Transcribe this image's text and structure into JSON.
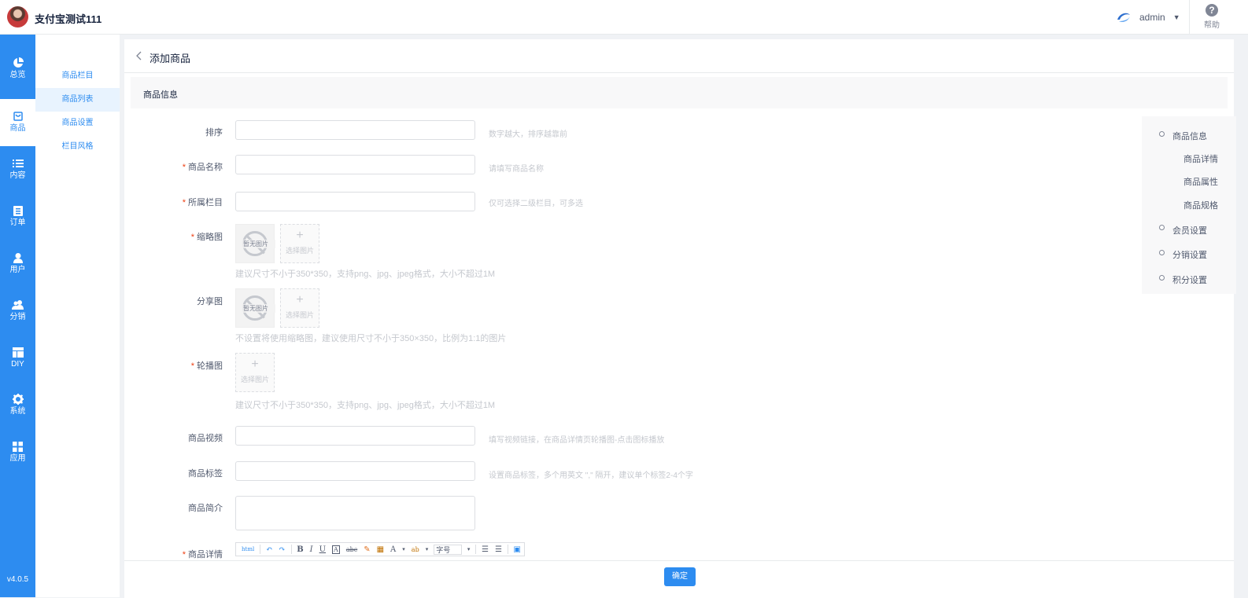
{
  "topbar": {
    "brand": "支付宝测试111",
    "user": "admin",
    "help_label": "帮助",
    "help_glyph": "?"
  },
  "nav": {
    "items": [
      {
        "label": "总览",
        "icon": "pie-chart-icon"
      },
      {
        "label": "商品",
        "icon": "shopping-bag-icon"
      },
      {
        "label": "内容",
        "icon": "list-icon"
      },
      {
        "label": "订单",
        "icon": "document-icon"
      },
      {
        "label": "用户",
        "icon": "user-icon"
      },
      {
        "label": "分销",
        "icon": "users-icon"
      },
      {
        "label": "DIY",
        "icon": "layout-icon"
      },
      {
        "label": "系统",
        "icon": "gear-icon"
      },
      {
        "label": "应用",
        "icon": "apps-icon"
      }
    ],
    "active": "商品",
    "version": "v4.0.5"
  },
  "subnav": {
    "items": [
      "商品栏目",
      "商品列表",
      "商品设置",
      "栏目风格"
    ],
    "active": "商品列表"
  },
  "page": {
    "title": "添加商品",
    "section_title": "商品信息"
  },
  "form": {
    "sort": {
      "label": "排序",
      "hint": "数字越大，排序越靠前"
    },
    "name": {
      "label": "商品名称",
      "hint": "请填写商品名称"
    },
    "category": {
      "label": "所属栏目",
      "hint": "仅可选择二级栏目，可多选"
    },
    "thumbnail": {
      "label": "缩略图",
      "hint": "建议尺寸不小于350*350，支持png、jpg、jpeg格式，大小不超过1M"
    },
    "share_image": {
      "label": "分享图",
      "hint": "不设置将使用缩略图，建议使用尺寸不小于350×350，比例为1:1的图片"
    },
    "carousel": {
      "label": "轮播图",
      "hint": "建议尺寸不小于350*350，支持png、jpg、jpeg格式，大小不超过1M"
    },
    "video": {
      "label": "商品视频",
      "hint": "填写视频链接，在商品详情页轮播图-点击图标播放"
    },
    "tags": {
      "label": "商品标签",
      "hint": "设置商品标签，多个用英文 \",\" 隔开，建议单个标签2-4个字"
    },
    "intro": {
      "label": "商品简介"
    },
    "detail": {
      "label": "商品详情"
    },
    "no_image_text": "暂无图片",
    "upload_text": "选择图片",
    "upload_plus": "+"
  },
  "editor": {
    "tools": [
      "html",
      "↶",
      "↷",
      "B",
      "I",
      "U",
      "A",
      "abc",
      "✎",
      "▦",
      "A",
      "ab"
    ],
    "font_size_placeholder": "字号"
  },
  "footer": {
    "confirm_label": "确定"
  },
  "anchor_nav": {
    "items": [
      {
        "label": "商品信息",
        "level": 1
      },
      {
        "label": "商品详情",
        "level": 2
      },
      {
        "label": "商品属性",
        "level": 2
      },
      {
        "label": "商品规格",
        "level": 2
      },
      {
        "label": "会员设置",
        "level": 1
      },
      {
        "label": "分销设置",
        "level": 1
      },
      {
        "label": "积分设置",
        "level": 1
      }
    ]
  },
  "colors": {
    "primary": "#2d8cf0",
    "required": "#ed4014",
    "hint": "#c5c8ce"
  }
}
